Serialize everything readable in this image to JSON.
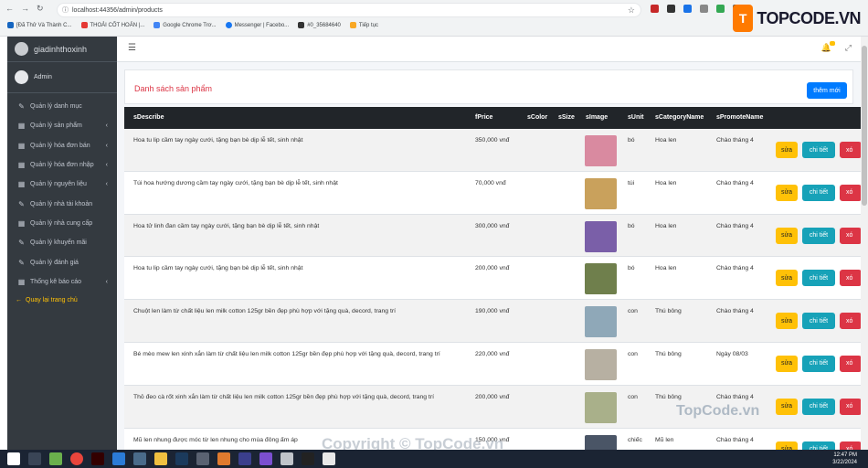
{
  "browser": {
    "url": "localhost:44356/admin/products",
    "bookmarks": [
      "[Đã Thử Và Thành C...",
      "THOẢI CỐT HOẢN |...",
      "Google Chrome Trơ...",
      "Messenger | Facebo...",
      "#0_35684640",
      "Tiếp tục"
    ]
  },
  "logo": {
    "text": "TOPCODE.VN"
  },
  "sidebar": {
    "brand": "giadinhthoxinh",
    "user": "Admin",
    "items": [
      {
        "label": "Quản lý danh mục",
        "icon": "edit-icon",
        "chevron": false
      },
      {
        "label": "Quản lý sản phẩm",
        "icon": "grid-icon",
        "chevron": true
      },
      {
        "label": "Quản lý hóa đơn bán",
        "icon": "grid-icon",
        "chevron": true
      },
      {
        "label": "Quản lý hóa đơn nhập",
        "icon": "grid-icon",
        "chevron": true
      },
      {
        "label": "Quản lý nguyên liệu",
        "icon": "grid-icon",
        "chevron": true
      },
      {
        "label": "Quản lý nhà tài khoản",
        "icon": "edit-icon",
        "chevron": false
      },
      {
        "label": "Quản lý nhà cung cấp",
        "icon": "grid-icon",
        "chevron": false
      },
      {
        "label": "Quản lý khuyến mãi",
        "icon": "edit-icon",
        "chevron": false
      },
      {
        "label": "Quản lý đánh giá",
        "icon": "edit-icon",
        "chevron": false
      },
      {
        "label": "Thống kê báo cáo",
        "icon": "grid-icon",
        "chevron": true
      }
    ],
    "back": "Quay lại trang chủ"
  },
  "page": {
    "title": "Danh sách sản phẩm",
    "add_label": "thêm mới"
  },
  "table": {
    "headers": [
      "sDescribe",
      "fPrice",
      "sColor",
      "sSize",
      "sImage",
      "sUnit",
      "sCategoryName",
      "sPromoteName"
    ],
    "actions": {
      "edit": "sửa",
      "detail": "chi tiết",
      "delete": "xó"
    },
    "rows": [
      {
        "describe": "Hoa tu lip cầm tay ngày cưới, tặng bạn bè dịp lễ tết, sinh nhật",
        "price": "350,000 vnđ",
        "unit": "bó",
        "category": "Hoa len",
        "promote": "Chào tháng 4",
        "thumb": "#d98aa0"
      },
      {
        "describe": "Túi hoa hướng dương cầm tay ngày cưới, tặng bạn bè dịp lễ tết, sinh nhật",
        "price": "70,000 vnđ",
        "unit": "túi",
        "category": "Hoa len",
        "promote": "Chào tháng 4",
        "thumb": "#c9a15c"
      },
      {
        "describe": "Hoa tử linh đan cầm tay ngày cưới, tặng bạn bè dịp lễ tết, sinh nhật",
        "price": "300,000 vnđ",
        "unit": "bó",
        "category": "Hoa len",
        "promote": "Chào tháng 4",
        "thumb": "#7a5fa8"
      },
      {
        "describe": "Hoa tu lip cầm tay ngày cưới, tặng bạn bè dịp lễ tết, sinh nhật",
        "price": "200,000 vnđ",
        "unit": "bó",
        "category": "Hoa len",
        "promote": "Chào tháng 4",
        "thumb": "#6f7f4c"
      },
      {
        "describe": "Chuột len làm từ chất liệu len milk cotton 125gr bền đẹp phù hợp với tặng quà, decord, trang trí",
        "price": "190,000 vnđ",
        "unit": "con",
        "category": "Thú bông",
        "promote": "Chào tháng 4",
        "thumb": "#8fa8b8"
      },
      {
        "describe": "Bé mèo mew len xinh xắn làm từ chất liệu len milk cotton 125gr bền đẹp phù hợp với tặng quà, decord, trang trí",
        "price": "220,000 vnđ",
        "unit": "con",
        "category": "Thú bông",
        "promote": "Ngày 08/03",
        "thumb": "#b7b0a2"
      },
      {
        "describe": "Thỏ đeo cà rốt xinh xắn làm từ chất liệu len milk cotton 125gr bền đẹp phù hợp với tặng quà, decord, trang trí",
        "price": "200,000 vnđ",
        "unit": "con",
        "category": "Thú bông",
        "promote": "Chào tháng 4",
        "thumb": "#a9b08a"
      },
      {
        "describe": "Mũ len nhung được móc từ len nhung cho mùa đông ấm áp",
        "price": "150,000 vnđ",
        "unit": "chiếc",
        "category": "Mũ len",
        "promote": "Chào tháng 4",
        "thumb": "#4a5566"
      }
    ]
  },
  "watermarks": {
    "top": "TopCode.vn",
    "bottom": "Copyright © TopCode.vn"
  },
  "clock": {
    "time": "12:47 PM",
    "date": "3/22/2024"
  }
}
